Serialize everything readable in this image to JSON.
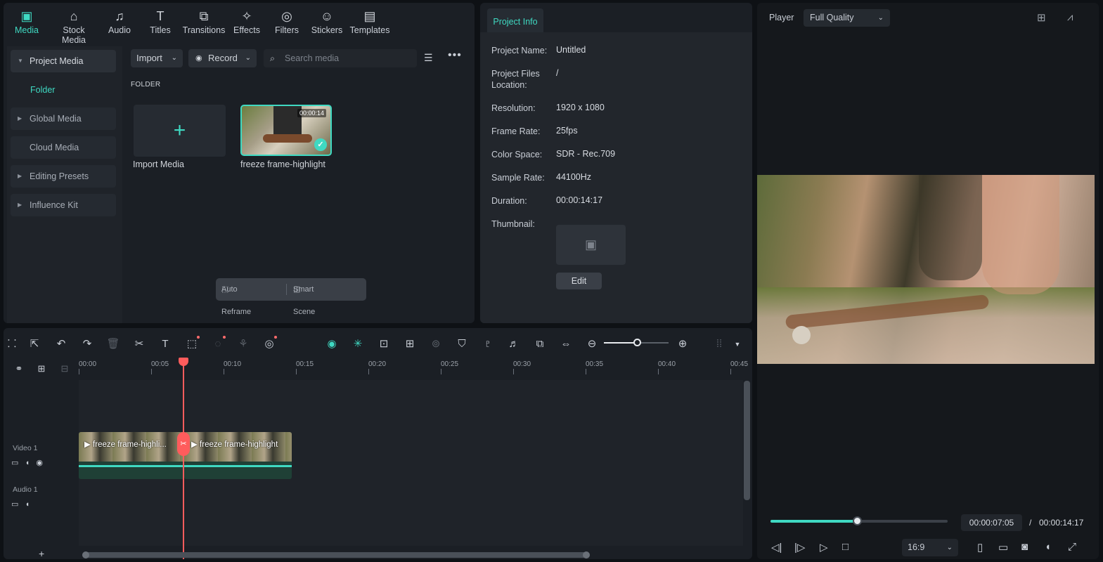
{
  "tabs": [
    {
      "label": "Media",
      "icon": "media-icon",
      "glyph": "▣"
    },
    {
      "label": "Stock Media",
      "icon": "store-icon",
      "glyph": "⌂"
    },
    {
      "label": "Audio",
      "icon": "music-icon",
      "glyph": "♫"
    },
    {
      "label": "Titles",
      "icon": "text-icon",
      "glyph": "T"
    },
    {
      "label": "Transitions",
      "icon": "transitions-icon",
      "glyph": "⧉"
    },
    {
      "label": "Effects",
      "icon": "effects-icon",
      "glyph": "✧"
    },
    {
      "label": "Filters",
      "icon": "filters-icon",
      "glyph": "◎"
    },
    {
      "label": "Stickers",
      "icon": "stickers-icon",
      "glyph": "☺"
    },
    {
      "label": "Templates",
      "icon": "templates-icon",
      "glyph": "▤"
    }
  ],
  "sidebar": {
    "project_media": "Project Media",
    "folder": "Folder",
    "global_media": "Global Media",
    "cloud_media": "Cloud Media",
    "editing_presets": "Editing Presets",
    "influence_kit": "Influence Kit"
  },
  "media_toolbar": {
    "import": "Import",
    "record": "Record",
    "search_placeholder": "Search media"
  },
  "media": {
    "folder_label": "FOLDER",
    "import_label": "Import Media",
    "clip_name": "freeze frame-highlight",
    "clip_duration": "00:00:14"
  },
  "float_bar": {
    "auto_reframe": "Auto Reframe",
    "smart_scene_cut": "Smart Scene Cut"
  },
  "project_info": {
    "tab": "Project Info",
    "rows": [
      {
        "key": "Project Name:",
        "val": "Untitled"
      },
      {
        "key": "Project Files Location:",
        "val": "/"
      },
      {
        "key": "Resolution:",
        "val": "1920 x 1080"
      },
      {
        "key": "Frame Rate:",
        "val": "25fps"
      },
      {
        "key": "Color Space:",
        "val": "SDR - Rec.709"
      },
      {
        "key": "Sample Rate:",
        "val": "44100Hz"
      },
      {
        "key": "Duration:",
        "val": "00:00:14:17"
      },
      {
        "key": "Thumbnail:",
        "val": ""
      }
    ],
    "edit": "Edit"
  },
  "player": {
    "label": "Player",
    "quality": "Full Quality",
    "current_time": "00:00:07:05",
    "separator": "/",
    "total_time": "00:00:14:17",
    "progress": 0.49,
    "ratio": "16:9"
  },
  "timeline": {
    "ticks": [
      "00:00",
      "00:05",
      "00:10",
      "00:15",
      "00:20",
      "00:25",
      "00:30",
      "00:35",
      "00:40",
      "00:45"
    ],
    "video_track": "Video 1",
    "audio_track": "Audio 1",
    "clip_a": "freeze frame-highli...",
    "clip_b": "freeze frame-highlight"
  },
  "colors": {
    "accent": "#3fd9c2",
    "playhead": "#ff5c5c"
  }
}
